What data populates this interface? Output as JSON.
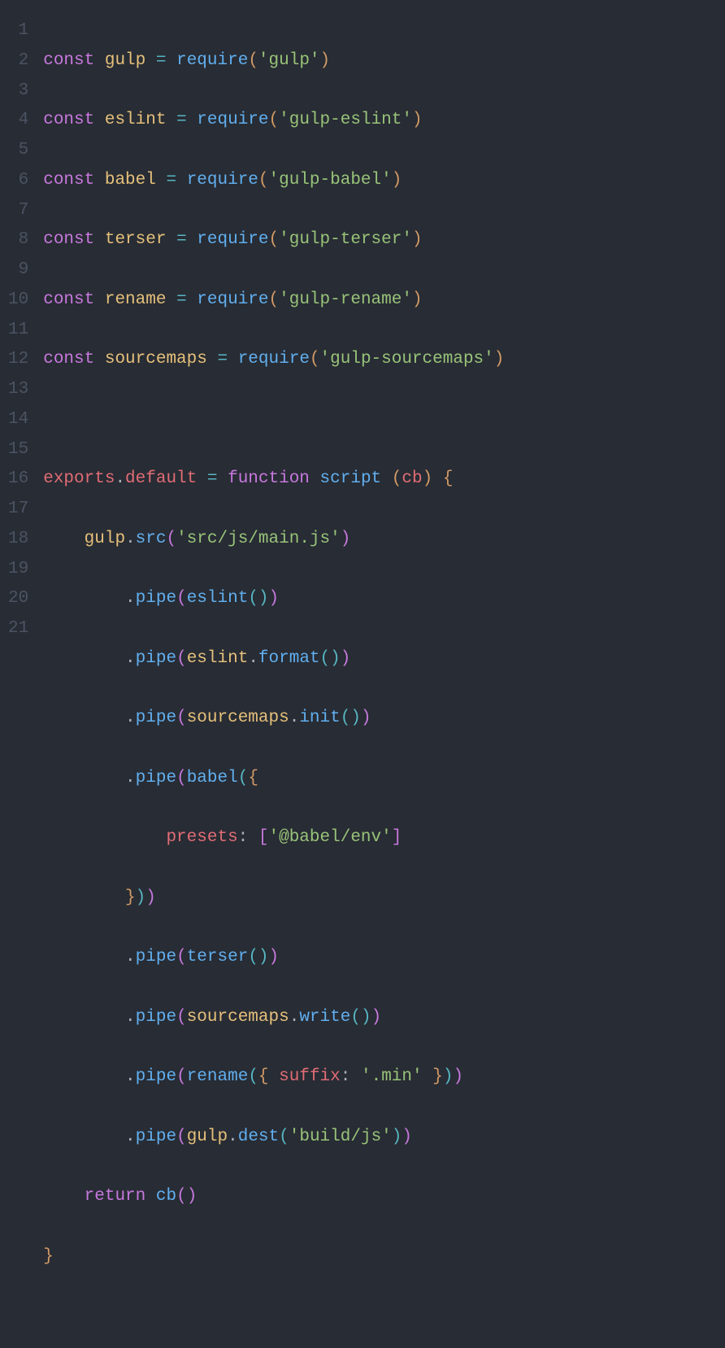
{
  "code": {
    "lines": 21,
    "line1": {
      "kw": "const",
      "var": "gulp",
      "eq": "=",
      "fn": "require",
      "lp": "(",
      "str": "'gulp'",
      "rp": ")"
    },
    "line2": {
      "kw": "const",
      "var": "eslint",
      "eq": "=",
      "fn": "require",
      "lp": "(",
      "str": "'gulp-eslint'",
      "rp": ")"
    },
    "line3": {
      "kw": "const",
      "var": "babel",
      "eq": "=",
      "fn": "require",
      "lp": "(",
      "str": "'gulp-babel'",
      "rp": ")"
    },
    "line4": {
      "kw": "const",
      "var": "terser",
      "eq": "=",
      "fn": "require",
      "lp": "(",
      "str": "'gulp-terser'",
      "rp": ")"
    },
    "line5": {
      "kw": "const",
      "var": "rename",
      "eq": "=",
      "fn": "require",
      "lp": "(",
      "str": "'gulp-rename'",
      "rp": ")"
    },
    "line6": {
      "kw": "const",
      "var": "sourcemaps",
      "eq": "=",
      "fn": "require",
      "lp": "(",
      "str": "'gulp-sourcemaps'",
      "rp": ")"
    },
    "line8": {
      "obj": "exports",
      "dot": ".",
      "prop": "default",
      "eq": "=",
      "kw": "function",
      "name": "script",
      "lp": "(",
      "param": "cb",
      "rp": ")",
      "brace": "{"
    },
    "line9": {
      "obj": "gulp",
      "dot": ".",
      "fn": "src",
      "lp": "(",
      "str": "'src/js/main.js'",
      "rp": ")"
    },
    "line10": {
      "dot": ".",
      "fn": "pipe",
      "lp": "(",
      "call": "eslint",
      "lp2": "(",
      "rp2": ")",
      "rp": ")"
    },
    "line11": {
      "dot": ".",
      "fn": "pipe",
      "lp": "(",
      "obj": "eslint",
      "dot2": ".",
      "call": "format",
      "lp2": "(",
      "rp2": ")",
      "rp": ")"
    },
    "line12": {
      "dot": ".",
      "fn": "pipe",
      "lp": "(",
      "obj": "sourcemaps",
      "dot2": ".",
      "call": "init",
      "lp2": "(",
      "rp2": ")",
      "rp": ")"
    },
    "line13": {
      "dot": ".",
      "fn": "pipe",
      "lp": "(",
      "call": "babel",
      "lp2": "(",
      "brace": "{"
    },
    "line14": {
      "key": "presets",
      "colon": ":",
      "lb": "[",
      "str": "'@babel/env'",
      "rb": "]"
    },
    "line15": {
      "brace": "}",
      "rp2": ")",
      "rp": ")"
    },
    "line16": {
      "dot": ".",
      "fn": "pipe",
      "lp": "(",
      "call": "terser",
      "lp2": "(",
      "rp2": ")",
      "rp": ")"
    },
    "line17": {
      "dot": ".",
      "fn": "pipe",
      "lp": "(",
      "obj": "sourcemaps",
      "dot2": ".",
      "call": "write",
      "lp2": "(",
      "rp2": ")",
      "rp": ")"
    },
    "line18": {
      "dot": ".",
      "fn": "pipe",
      "lp": "(",
      "call": "rename",
      "lp2": "(",
      "brace": "{",
      "key": "suffix",
      "colon": ":",
      "str": "'.min'",
      "brace2": "}",
      "rp2": ")",
      "rp": ")"
    },
    "line19": {
      "dot": ".",
      "fn": "pipe",
      "lp": "(",
      "obj": "gulp",
      "dot2": ".",
      "call": "dest",
      "lp2": "(",
      "str": "'build/js'",
      "rp2": ")",
      "rp": ")"
    },
    "line20": {
      "kw": "return",
      "fn": "cb",
      "lp": "(",
      "rp": ")"
    },
    "line21": {
      "brace": "}"
    }
  },
  "gutter": {
    "n1": "1",
    "n2": "2",
    "n3": "3",
    "n4": "4",
    "n5": "5",
    "n6": "6",
    "n7": "7",
    "n8": "8",
    "n9": "9",
    "n10": "10",
    "n11": "11",
    "n12": "12",
    "n13": "13",
    "n14": "14",
    "n15": "15",
    "n16": "16",
    "n17": "17",
    "n18": "18",
    "n19": "19",
    "n20": "20",
    "n21": "21"
  }
}
